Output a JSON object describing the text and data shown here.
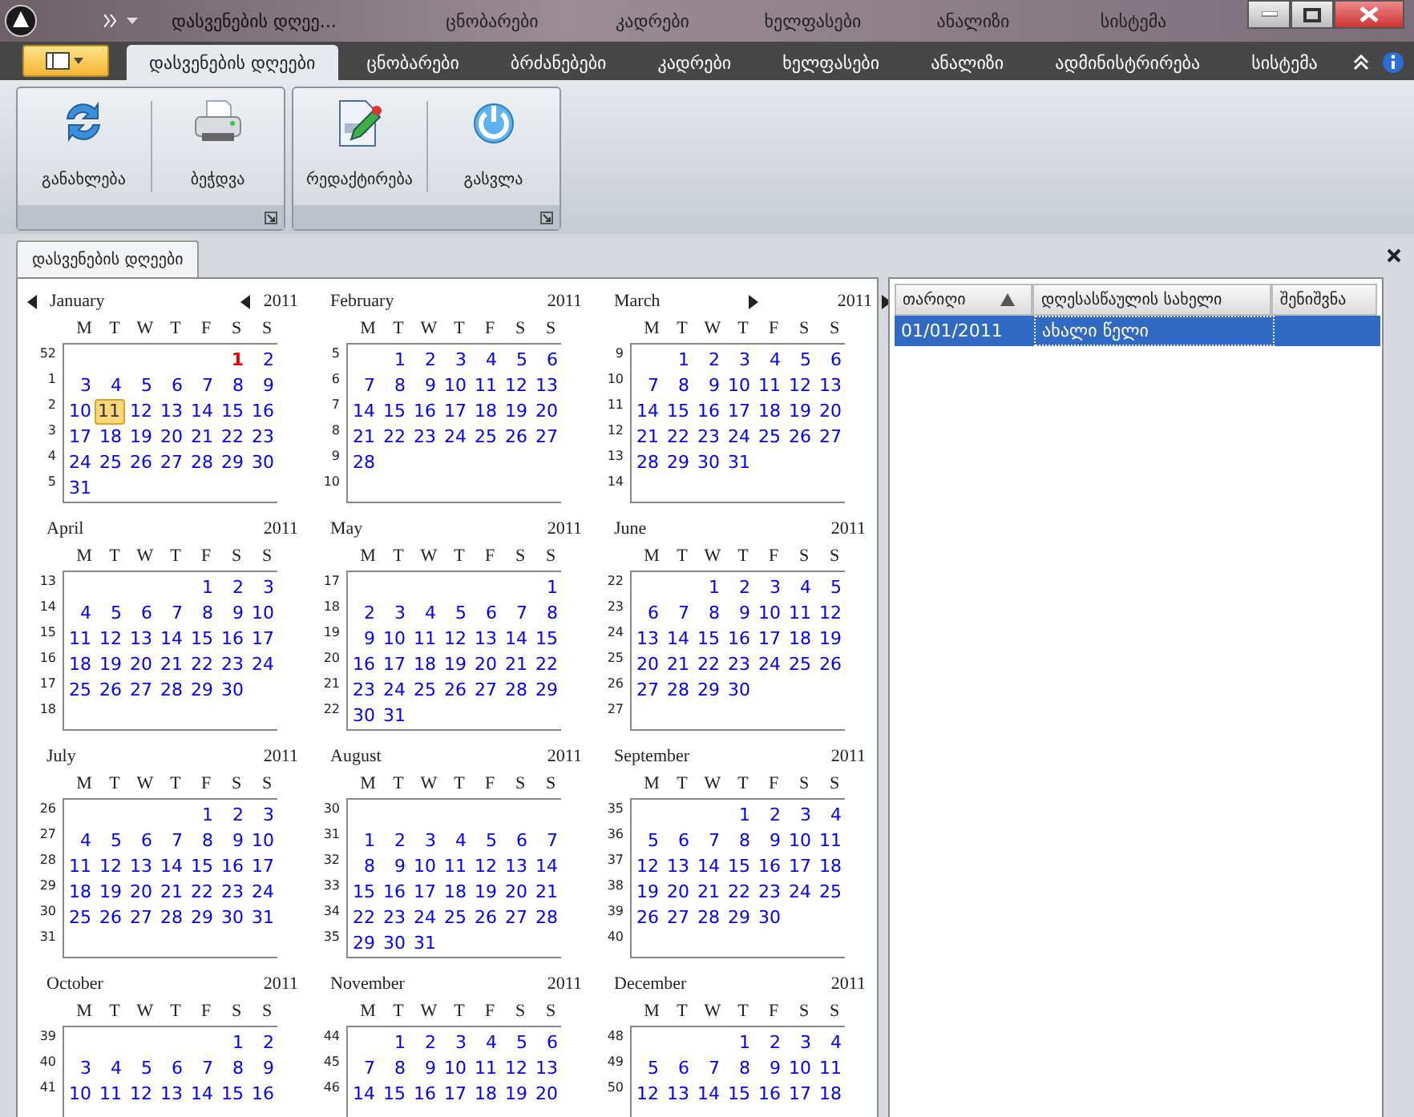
{
  "title_bar": {
    "title": "დასვენების დღეე...",
    "ghost_tabs": [
      "ცნობარები",
      "კადრები",
      "ხელფასები",
      "ანალიზი",
      "სისტემა"
    ]
  },
  "ribbon": {
    "tabs": [
      {
        "label": "დასვენების დღეები",
        "selected": true
      },
      {
        "label": "ცნობარები",
        "selected": false
      },
      {
        "label": "ბრძანებები",
        "selected": false
      },
      {
        "label": "კადრები",
        "selected": false
      },
      {
        "label": "ხელფასები",
        "selected": false
      },
      {
        "label": "ანალიზი",
        "selected": false
      },
      {
        "label": "ადმინისტრირება",
        "selected": false
      },
      {
        "label": "სისტემა",
        "selected": false
      }
    ],
    "groups": [
      {
        "buttons": [
          {
            "label": "განახლება",
            "kind": "refresh"
          },
          {
            "label": "ბეჭდვა",
            "kind": "print"
          }
        ]
      },
      {
        "buttons": [
          {
            "label": "რედაქტირება",
            "kind": "edit"
          },
          {
            "label": "გასვლა",
            "kind": "exit"
          }
        ]
      }
    ]
  },
  "document_tab": {
    "label": "დასვენების დღეები"
  },
  "calendar": {
    "months": [
      {
        "name": "January",
        "year": "2011",
        "weekdays": [
          "M",
          "T",
          "W",
          "T",
          "F",
          "S",
          "S"
        ],
        "weeks": [
          {
            "week": "52",
            "days": [
              {
                "day": "1",
                "kind": "holiday"
              },
              "2"
            ]
          },
          {
            "week": "1",
            "days": [
              "3",
              "4",
              "5",
              "6",
              "7",
              "8",
              "9"
            ]
          },
          {
            "week": "2",
            "days": [
              "10",
              {
                "day": "11",
                "kind": "today"
              },
              "12",
              "13",
              "14",
              "15",
              "16"
            ]
          },
          {
            "week": "3",
            "days": [
              "17",
              "18",
              "19",
              "20",
              "21",
              "22",
              "23"
            ]
          },
          {
            "week": "4",
            "days": [
              "24",
              "25",
              "26",
              "27",
              "28",
              "29",
              "30"
            ]
          },
          {
            "week": "5",
            "days": [
              "31"
            ]
          }
        ]
      },
      {
        "name": "February",
        "year": "2011",
        "weekdays": [
          "M",
          "T",
          "W",
          "T",
          "F",
          "S",
          "S"
        ],
        "weeks": [
          {
            "week": "5",
            "days": [
              "1",
              "2",
              "3",
              "4",
              "5",
              "6"
            ]
          },
          {
            "week": "6",
            "days": [
              "7",
              "8",
              "9",
              "10",
              "11",
              "12",
              "13"
            ]
          },
          {
            "week": "7",
            "days": [
              "14",
              "15",
              "16",
              "17",
              "18",
              "19",
              "20"
            ]
          },
          {
            "week": "8",
            "days": [
              "21",
              "22",
              "23",
              "24",
              "25",
              "26",
              "27"
            ]
          },
          {
            "week": "9",
            "days": [
              "28"
            ]
          },
          {
            "week": "10"
          }
        ]
      },
      {
        "name": "March",
        "year": "2011",
        "weekdays": [
          "M",
          "T",
          "W",
          "T",
          "F",
          "S",
          "S"
        ],
        "weeks": [
          {
            "week": "9",
            "days": [
              "1",
              "2",
              "3",
              "4",
              "5",
              "6"
            ]
          },
          {
            "week": "10",
            "days": [
              "7",
              "8",
              "9",
              "10",
              "11",
              "12",
              "13"
            ]
          },
          {
            "week": "11",
            "days": [
              "14",
              "15",
              "16",
              "17",
              "18",
              "19",
              "20"
            ]
          },
          {
            "week": "12",
            "days": [
              "21",
              "22",
              "23",
              "24",
              "25",
              "26",
              "27"
            ]
          },
          {
            "week": "13",
            "days": [
              "28",
              "29",
              "30",
              "31"
            ]
          },
          {
            "week": "14"
          }
        ]
      },
      {
        "name": "April",
        "year": "2011",
        "weekdays": [
          "M",
          "T",
          "W",
          "T",
          "F",
          "S",
          "S"
        ],
        "weeks": [
          {
            "week": "13",
            "days": [
              "1",
              "2",
              "3"
            ]
          },
          {
            "week": "14",
            "days": [
              "4",
              "5",
              "6",
              "7",
              "8",
              "9",
              "10"
            ]
          },
          {
            "week": "15",
            "days": [
              "11",
              "12",
              "13",
              "14",
              "15",
              "16",
              "17"
            ]
          },
          {
            "week": "16",
            "days": [
              "18",
              "19",
              "20",
              "21",
              "22",
              "23",
              "24"
            ]
          },
          {
            "week": "17",
            "days": [
              "25",
              "26",
              "27",
              "28",
              "29",
              "30"
            ]
          },
          {
            "week": "18"
          }
        ]
      },
      {
        "name": "May",
        "year": "2011",
        "weekdays": [
          "M",
          "T",
          "W",
          "T",
          "F",
          "S",
          "S"
        ],
        "weeks": [
          {
            "week": "17",
            "days": [
              "1"
            ]
          },
          {
            "week": "18",
            "days": [
              "2",
              "3",
              "4",
              "5",
              "6",
              "7",
              "8"
            ]
          },
          {
            "week": "19",
            "days": [
              "9",
              "10",
              "11",
              "12",
              "13",
              "14",
              "15"
            ]
          },
          {
            "week": "20",
            "days": [
              "16",
              "17",
              "18",
              "19",
              "20",
              "21",
              "22"
            ]
          },
          {
            "week": "21",
            "days": [
              "23",
              "24",
              "25",
              "26",
              "27",
              "28",
              "29"
            ]
          },
          {
            "week": "22",
            "days": [
              "30",
              "31"
            ]
          }
        ]
      },
      {
        "name": "June",
        "year": "2011",
        "weekdays": [
          "M",
          "T",
          "W",
          "T",
          "F",
          "S",
          "S"
        ],
        "weeks": [
          {
            "week": "22",
            "days": [
              "1",
              "2",
              "3",
              "4",
              "5"
            ]
          },
          {
            "week": "23",
            "days": [
              "6",
              "7",
              "8",
              "9",
              "10",
              "11",
              "12"
            ]
          },
          {
            "week": "24",
            "days": [
              "13",
              "14",
              "15",
              "16",
              "17",
              "18",
              "19"
            ]
          },
          {
            "week": "25",
            "days": [
              "20",
              "21",
              "22",
              "23",
              "24",
              "25",
              "26"
            ]
          },
          {
            "week": "26",
            "days": [
              "27",
              "28",
              "29",
              "30"
            ]
          },
          {
            "week": "27"
          }
        ]
      },
      {
        "name": "July",
        "year": "2011",
        "weekdays": [
          "M",
          "T",
          "W",
          "T",
          "F",
          "S",
          "S"
        ],
        "weeks": [
          {
            "week": "26",
            "days": [
              "1",
              "2",
              "3"
            ]
          },
          {
            "week": "27",
            "days": [
              "4",
              "5",
              "6",
              "7",
              "8",
              "9",
              "10"
            ]
          },
          {
            "week": "28",
            "days": [
              "11",
              "12",
              "13",
              "14",
              "15",
              "16",
              "17"
            ]
          },
          {
            "week": "29",
            "days": [
              "18",
              "19",
              "20",
              "21",
              "22",
              "23",
              "24"
            ]
          },
          {
            "week": "30",
            "days": [
              "25",
              "26",
              "27",
              "28",
              "29",
              "30",
              "31"
            ]
          },
          {
            "week": "31"
          }
        ]
      },
      {
        "name": "August",
        "year": "2011",
        "weekdays": [
          "M",
          "T",
          "W",
          "T",
          "F",
          "S",
          "S"
        ],
        "weeks": [
          {
            "week": "30"
          },
          {
            "week": "31",
            "days": [
              "1",
              "2",
              "3",
              "4",
              "5",
              "6",
              "7"
            ]
          },
          {
            "week": "32",
            "days": [
              "8",
              "9",
              "10",
              "11",
              "12",
              "13",
              "14"
            ]
          },
          {
            "week": "33",
            "days": [
              "15",
              "16",
              "17",
              "18",
              "19",
              "20",
              "21"
            ]
          },
          {
            "week": "34",
            "days": [
              "22",
              "23",
              "24",
              "25",
              "26",
              "27",
              "28"
            ]
          },
          {
            "week": "35",
            "days": [
              "29",
              "30",
              "31"
            ]
          }
        ]
      },
      {
        "name": "September",
        "year": "2011",
        "weekdays": [
          "M",
          "T",
          "W",
          "T",
          "F",
          "S",
          "S"
        ],
        "weeks": [
          {
            "week": "35",
            "days": [
              "1",
              "2",
              "3",
              "4"
            ]
          },
          {
            "week": "36",
            "days": [
              "5",
              "6",
              "7",
              "8",
              "9",
              "10",
              "11"
            ]
          },
          {
            "week": "37",
            "days": [
              "12",
              "13",
              "14",
              "15",
              "16",
              "17",
              "18"
            ]
          },
          {
            "week": "38",
            "days": [
              "19",
              "20",
              "21",
              "22",
              "23",
              "24",
              "25"
            ]
          },
          {
            "week": "39",
            "days": [
              "26",
              "27",
              "28",
              "29",
              "30"
            ]
          },
          {
            "week": "40"
          }
        ]
      },
      {
        "name": "October",
        "year": "2011",
        "weekdays": [
          "M",
          "T",
          "W",
          "T",
          "F",
          "S",
          "S"
        ],
        "weeks": [
          {
            "week": "39",
            "days": [
              "1",
              "2"
            ]
          },
          {
            "week": "40",
            "days": [
              "3",
              "4",
              "5",
              "6",
              "7",
              "8",
              "9"
            ]
          },
          {
            "week": "41",
            "days": [
              "10",
              "11",
              "12",
              "13",
              "14",
              "15",
              "16"
            ]
          }
        ]
      },
      {
        "name": "November",
        "year": "2011",
        "weekdays": [
          "M",
          "T",
          "W",
          "T",
          "F",
          "S",
          "S"
        ],
        "weeks": [
          {
            "week": "44",
            "days": [
              "1",
              "2",
              "3",
              "4",
              "5",
              "6"
            ]
          },
          {
            "week": "45",
            "days": [
              "7",
              "8",
              "9",
              "10",
              "11",
              "12",
              "13"
            ]
          },
          {
            "week": "46",
            "days": [
              "14",
              "15",
              "16",
              "17",
              "18",
              "19",
              "20"
            ]
          }
        ]
      },
      {
        "name": "December",
        "year": "2011",
        "weekdays": [
          "M",
          "T",
          "W",
          "T",
          "F",
          "S",
          "S"
        ],
        "weeks": [
          {
            "week": "48",
            "days": [
              "1",
              "2",
              "3",
              "4"
            ]
          },
          {
            "week": "49",
            "days": [
              "5",
              "6",
              "7",
              "8",
              "9",
              "10",
              "11"
            ]
          },
          {
            "week": "50",
            "days": [
              "12",
              "13",
              "14",
              "15",
              "16",
              "17",
              "18"
            ]
          }
        ]
      }
    ]
  },
  "holidays_table": {
    "columns": [
      {
        "label": "თარიღი",
        "sorted_ascending": true
      },
      {
        "label": "დღესასწაულის სახელი",
        "sorted_ascending": false
      },
      {
        "label": "შენიშვნა",
        "sorted_ascending": false
      }
    ],
    "rows": [
      {
        "cells": [
          "01/01/2011",
          "ახალი წელი"
        ],
        "selected": true
      }
    ]
  }
}
